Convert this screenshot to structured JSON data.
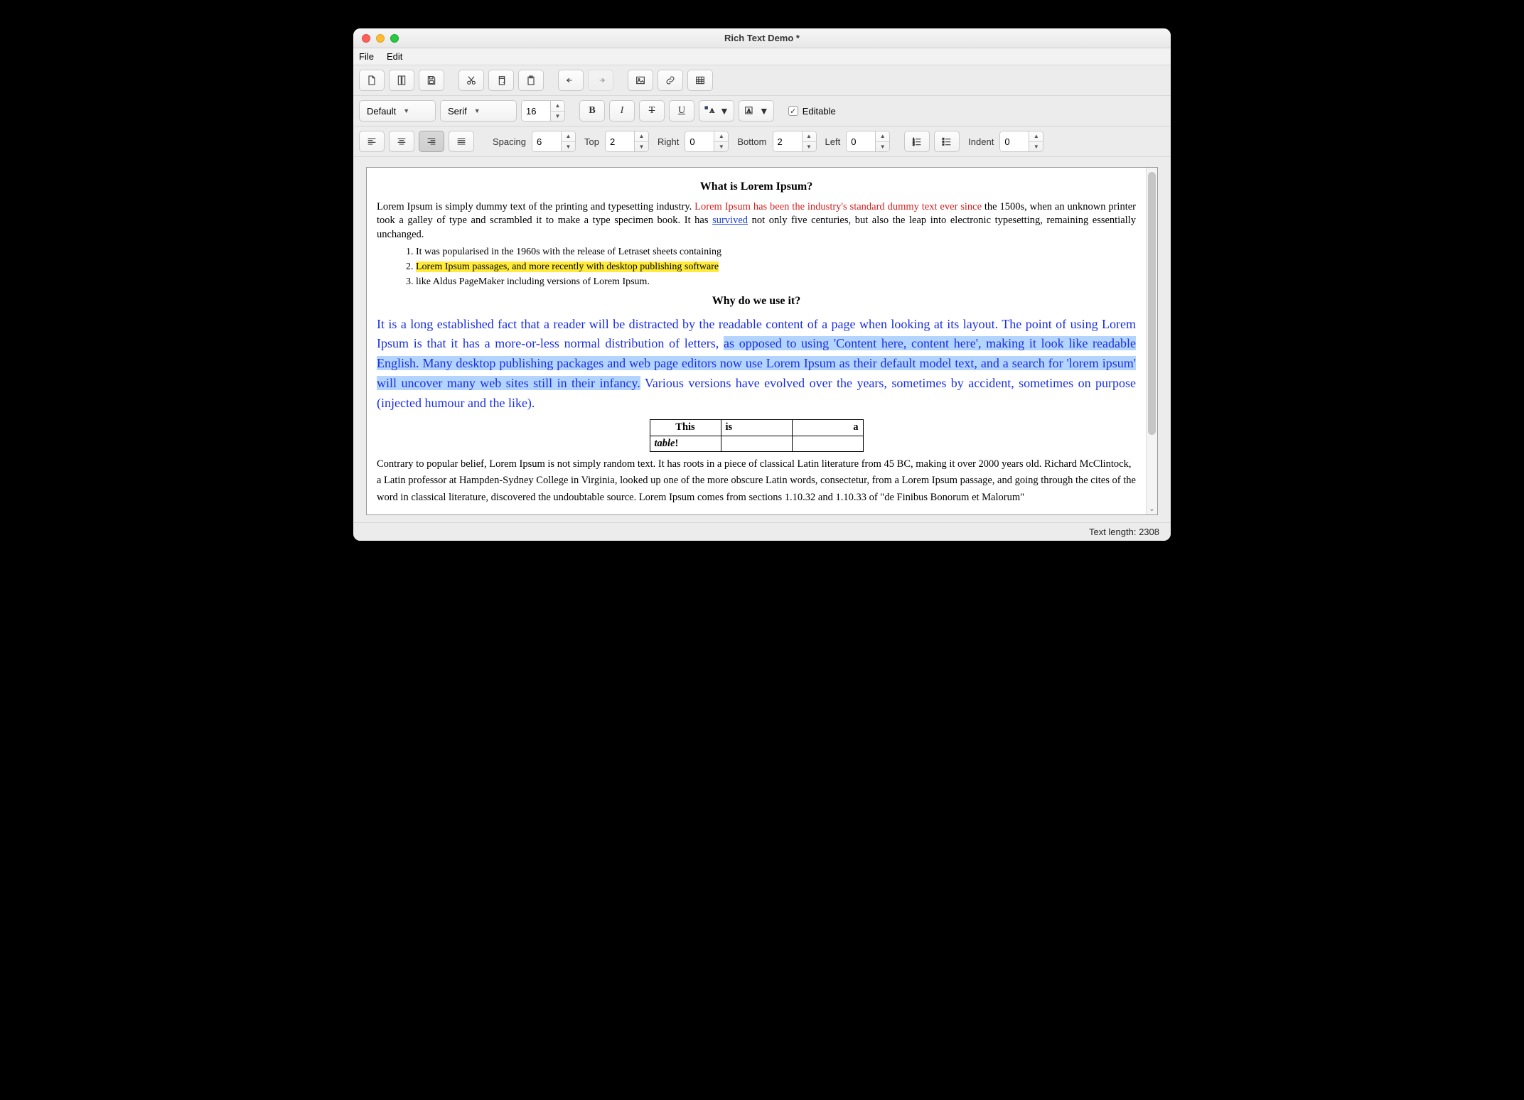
{
  "window": {
    "title": "Rich Text Demo *"
  },
  "menu": {
    "file": "File",
    "edit": "Edit"
  },
  "toolbar2": {
    "style": "Default",
    "font": "Serif",
    "size": "16",
    "editable_label": "Editable"
  },
  "toolbar3": {
    "spacing_label": "Spacing",
    "spacing": "6",
    "top_label": "Top",
    "top": "2",
    "right_label": "Right",
    "right": "0",
    "bottom_label": "Bottom",
    "bottom": "2",
    "left_label": "Left",
    "left": "0",
    "indent_label": "Indent",
    "indent": "0"
  },
  "doc": {
    "h1": "What is Lorem Ipsum?",
    "p1a": "Lorem Ipsum is simply dummy text of the printing and typesetting industry. ",
    "p1red": "Lorem Ipsum has been the industry's standard dummy text ever since",
    "p1b": " the 1500s, when an unknown printer took a galley of type and scrambled it to make a type specimen book. It has ",
    "p1link": "survived",
    "p1c": " not only five centuries, but also the leap into electronic typesetting, remaining essentially unchanged.",
    "li1": "It was popularised in the 1960s with the release of Letraset sheets containing",
    "li2": "Lorem Ipsum passages, and more recently with desktop publishing software",
    "li3": "like Aldus PageMaker including versions of Lorem Ipsum.",
    "h2": "Why do we use it?",
    "p2a": "It is a long established fact that a reader will be distracted by the readable content of a page when looking at its layout. The point of using Lorem Ipsum is that it has a more-or-less normal distribution of letters, ",
    "p2sel": "as opposed to using 'Content here, content here', making it look like readable English. Many desktop publishing packages and web page editors now use Lorem Ipsum as their default model text, and a search for 'lorem ipsum' will uncover many web sites still in their infancy.",
    "p2b": " Various versions have evolved over the years, sometimes by accident, sometimes on purpose (injected humour and the like).",
    "table": {
      "r1": [
        "This",
        "is",
        "a"
      ],
      "r2": [
        "table",
        "!",
        "",
        ""
      ]
    },
    "p3": "Contrary to popular belief, Lorem Ipsum is not simply random text. It has roots in a piece of classical Latin literature from 45 BC, making it over 2000 years old. Richard McClintock, a Latin professor at Hampden-Sydney College in Virginia, looked up one of the more obscure Latin words, consectetur, from a Lorem Ipsum passage, and going through the cites of the word in classical literature, discovered the undoubtable source. Lorem Ipsum comes from sections 1.10.32 and 1.10.33 of \"de Finibus Bonorum et Malorum\""
  },
  "status": {
    "text": "Text length: 2308"
  }
}
